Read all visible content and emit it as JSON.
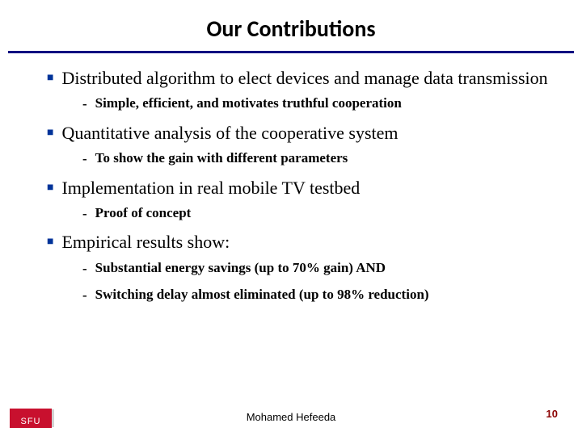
{
  "title": "Our Contributions",
  "items": [
    {
      "text": "Distributed algorithm to elect devices and manage data transmission",
      "sub": [
        "Simple, efficient, and motivates truthful cooperation"
      ]
    },
    {
      "text": "Quantitative analysis of the cooperative system",
      "sub": [
        "To show the gain with different parameters"
      ]
    },
    {
      "text": "Implementation in real mobile TV testbed",
      "sub": [
        "Proof of concept"
      ]
    },
    {
      "text": "Empirical results show:",
      "sub": [
        "Substantial energy savings  (up to 70% gain) AND",
        "Switching delay almost eliminated (up to 98% reduction)"
      ]
    }
  ],
  "footer": {
    "logo": "SFU",
    "author": "Mohamed  Hefeeda",
    "page": "10"
  }
}
